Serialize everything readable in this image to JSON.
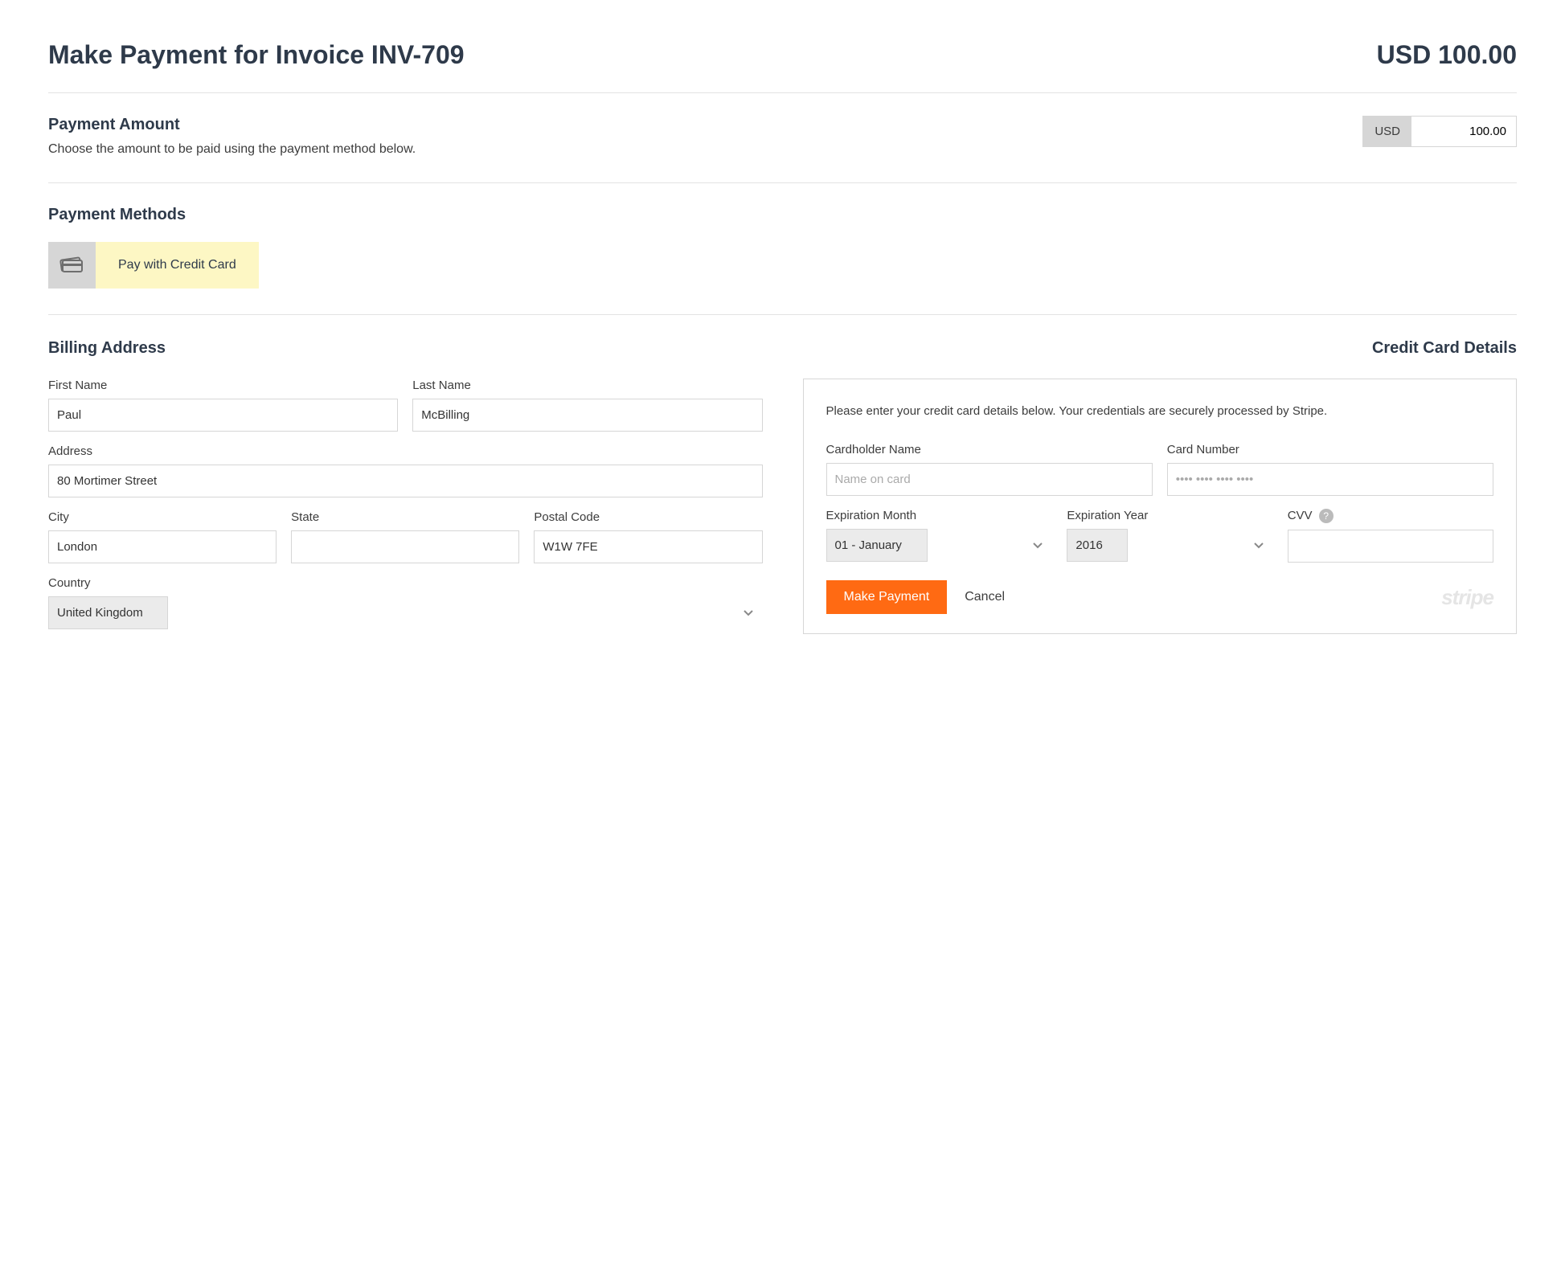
{
  "header": {
    "title": "Make Payment for Invoice INV-709",
    "amount_display": "USD 100.00"
  },
  "payment_amount": {
    "heading": "Payment Amount",
    "subtext": "Choose the amount to be paid using the payment method below.",
    "currency": "USD",
    "value": "100.00"
  },
  "payment_methods": {
    "heading": "Payment Methods",
    "selected_label": "Pay with Credit Card"
  },
  "billing": {
    "heading": "Billing Address",
    "first_name_label": "First Name",
    "first_name": "Paul",
    "last_name_label": "Last Name",
    "last_name": "McBilling",
    "address_label": "Address",
    "address": "80 Mortimer Street",
    "city_label": "City",
    "city": "London",
    "state_label": "State",
    "state": "",
    "postal_label": "Postal Code",
    "postal": "W1W 7FE",
    "country_label": "Country",
    "country": "United Kingdom"
  },
  "card": {
    "heading": "Credit Card Details",
    "note": "Please enter your credit card details below. Your credentials are securely processed by Stripe.",
    "holder_label": "Cardholder Name",
    "holder_placeholder": "Name on card",
    "number_label": "Card Number",
    "number_placeholder": "•••• •••• •••• ••••",
    "exp_month_label": "Expiration Month",
    "exp_month": "01 - January",
    "exp_year_label": "Expiration Year",
    "exp_year": "2016",
    "cvv_label": "CVV",
    "submit_label": "Make Payment",
    "cancel_label": "Cancel",
    "processor_mark": "stripe"
  }
}
